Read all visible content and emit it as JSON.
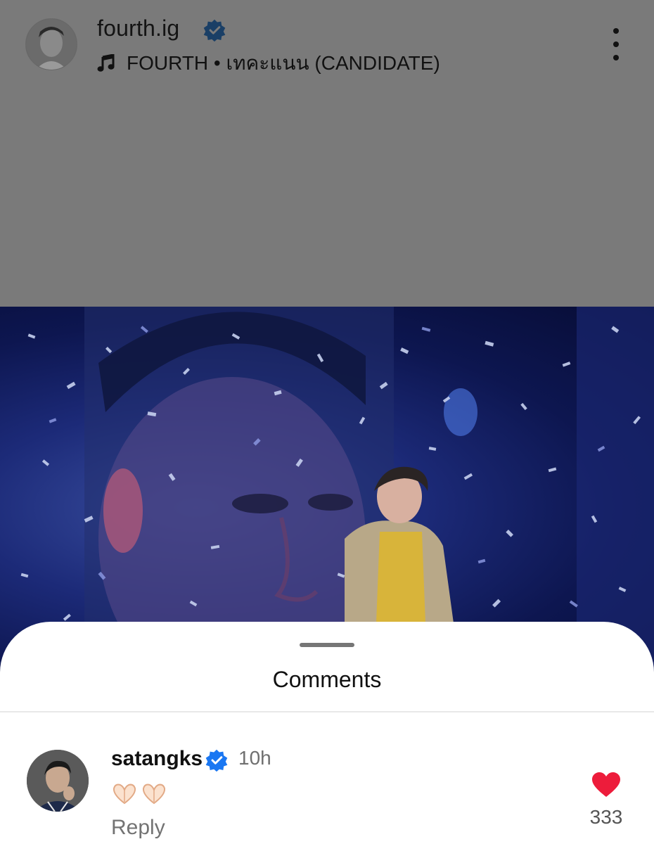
{
  "post": {
    "username": "fourth.ig",
    "music": "FOURTH • เทคะแนน (CANDIDATE)"
  },
  "sheet": {
    "title": "Comments"
  },
  "comment": {
    "username": "satangks",
    "time": "10h",
    "text_icons": [
      "heart-hands-emoji",
      "heart-hands-emoji"
    ],
    "reply_label": "Reply",
    "likes": "333"
  },
  "colors": {
    "verified": "#1a77f2",
    "like": "#ed1c3b",
    "dim_overlay": "#7a7a7a"
  },
  "icons": [
    "verified-icon",
    "music-note-icon",
    "more-options-icon",
    "heart-icon"
  ]
}
